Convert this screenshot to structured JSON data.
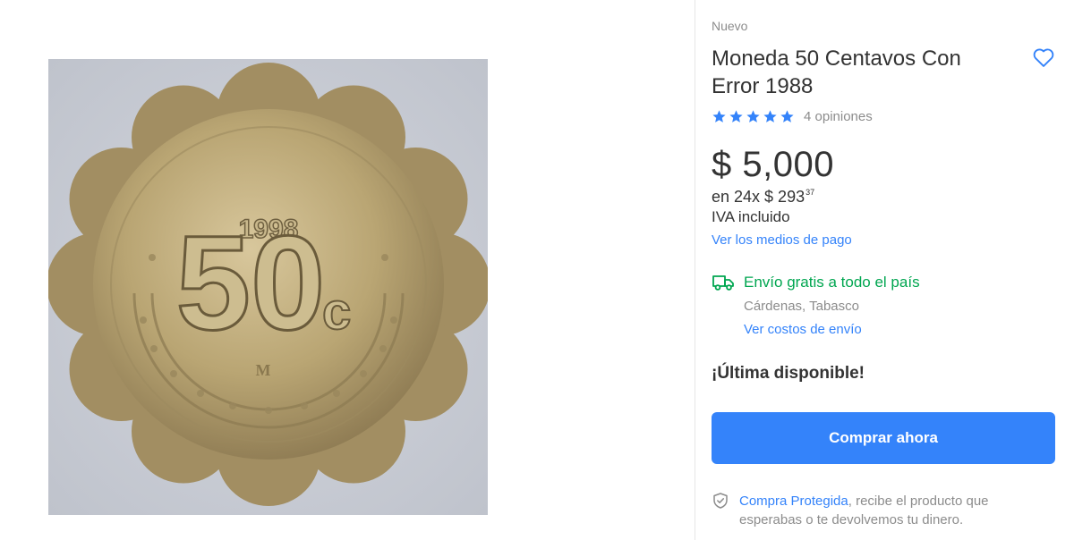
{
  "product": {
    "condition": "Nuevo",
    "title": "Moneda 50 Centavos Con Error 1988",
    "rating": 5,
    "reviews_text": "4 opiniones"
  },
  "price": {
    "amount": "$ 5,000",
    "installments_prefix": "en 24x $ 293",
    "installments_cents": "37",
    "tax_note": "IVA incluido",
    "payment_link": "Ver los medios de pago"
  },
  "shipping": {
    "title": "Envío gratis a todo el país",
    "location": "Cárdenas, Tabasco",
    "cost_link": "Ver costos de envío"
  },
  "stock": {
    "label": "¡Última disponible!"
  },
  "actions": {
    "buy_label": "Comprar ahora"
  },
  "protection": {
    "link": "Compra Protegida",
    "text": ", recibe el producto que esperabas o te devolvemos tu dinero."
  },
  "image": {
    "coin_year": "1998",
    "coin_value": "50",
    "coin_unit": "c"
  },
  "colors": {
    "accent": "#3483fa",
    "shipping_green": "#00a650",
    "muted": "#8c8c8c"
  },
  "icons": [
    "heart-icon",
    "star-icon",
    "truck-icon",
    "shield-check-icon"
  ]
}
